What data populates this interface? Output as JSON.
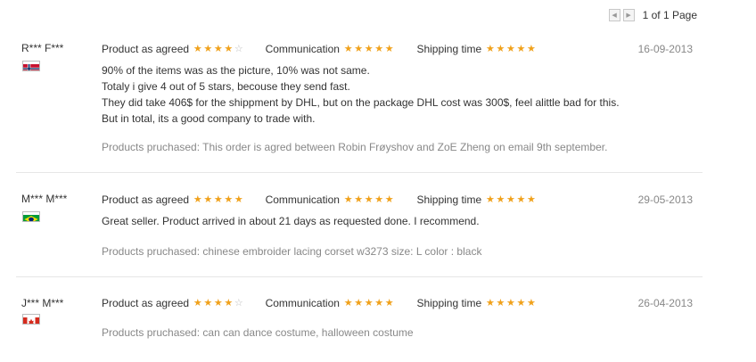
{
  "pager": {
    "prev_icon": "chevron-left-icon",
    "next_icon": "chevron-right-icon",
    "text": "1 of 1 Page"
  },
  "rating_labels": {
    "product": "Product as agreed",
    "communication": "Communication",
    "shipping": "Shipping time"
  },
  "reviews": [
    {
      "user": "R*** F***",
      "country_flag": "norway-flag-icon",
      "date": "16-09-2013",
      "ratings": {
        "product": 4,
        "communication": 5,
        "shipping": 5
      },
      "text": [
        "90% of the items was as the picture, 10% was not same.",
        "Totaly i give 4 out of 5 stars, becouse they send fast.",
        "They did take 406$ for the shippment by DHL, but on the package DHL cost was 300$, feel alittle bad for this.",
        "But in total, its a good company to trade with."
      ],
      "purchased": "Products pruchased: This order is agred between Robin Frøyshov and ZoE Zheng on email 9th september."
    },
    {
      "user": "M*** M***",
      "country_flag": "brazil-flag-icon",
      "date": "29-05-2013",
      "ratings": {
        "product": 5,
        "communication": 5,
        "shipping": 5
      },
      "text": [
        "Great seller. Product arrived in about 21 days as requested done. I recommend."
      ],
      "purchased": "Products pruchased: chinese embroider lacing corset w3273 size: L color : black"
    },
    {
      "user": "J*** M***",
      "country_flag": "canada-flag-icon",
      "date": "26-04-2013",
      "ratings": {
        "product": 4,
        "communication": 5,
        "shipping": 5
      },
      "text": [],
      "purchased": "Products pruchased: can can dance costume, halloween costume"
    }
  ],
  "colors": {
    "star_filled": "#f0a11b",
    "star_empty": "#bdbdbd",
    "muted_text": "#888888"
  }
}
